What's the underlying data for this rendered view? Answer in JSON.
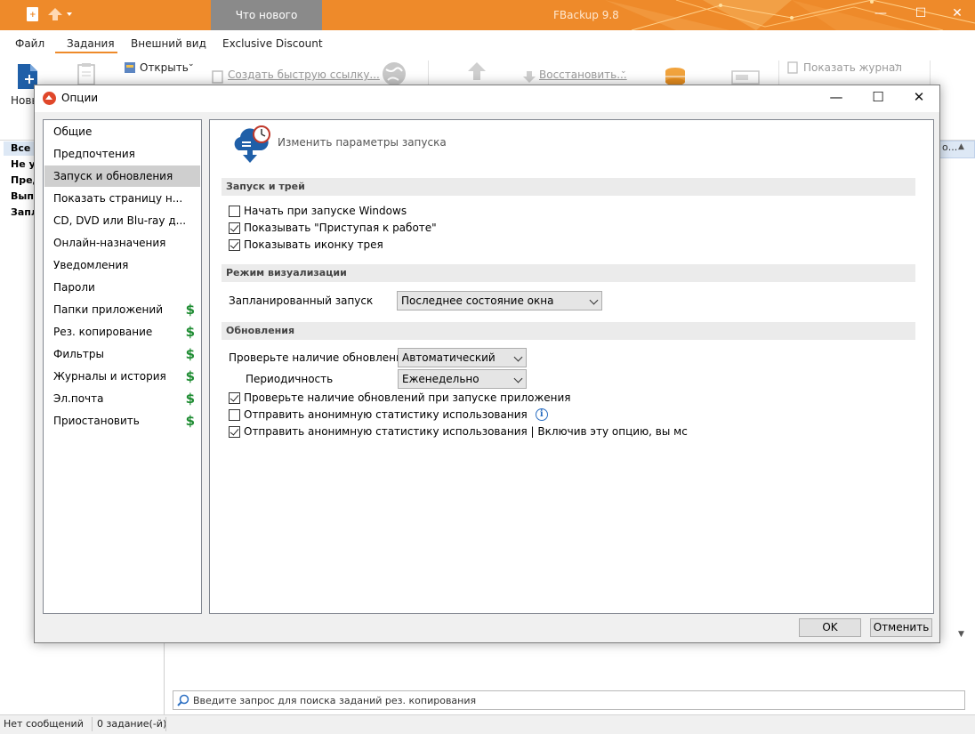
{
  "app": {
    "title": "FBackup 9.8",
    "whats_new": "Что нового",
    "window_controls": {
      "minimize": "—",
      "maximize": "☐",
      "close": "✕"
    }
  },
  "menu": [
    "Файл",
    "Задания",
    "Внешний вид",
    "Exclusive Discount"
  ],
  "ribbon": {
    "new_label": "Новы",
    "open_label": "Открыть",
    "quick_link_label": "Создать быструю ссылку...",
    "restore_label": "Восстановить...",
    "show_log_label": "Показать журнал"
  },
  "left_pane": {
    "items": [
      "Все з",
      "Не уд",
      "Пред",
      "Выпо",
      "Запл"
    ]
  },
  "right_column": {
    "header_tail": "о..."
  },
  "search": {
    "placeholder": "Введите запрос для поиска заданий рез. копирования"
  },
  "status": {
    "messages": "Нет сообщений",
    "jobs": "0 задание(-й)"
  },
  "dialog": {
    "title": "Опции",
    "nav": [
      {
        "label": "Общие",
        "paid": false,
        "selected": false
      },
      {
        "label": "Предпочтения",
        "paid": false,
        "selected": false
      },
      {
        "label": "Запуск и обновления",
        "paid": false,
        "selected": true
      },
      {
        "label": "Показать страницу н...",
        "paid": false,
        "selected": false
      },
      {
        "label": "CD, DVD или Blu-ray д...",
        "paid": false,
        "selected": false
      },
      {
        "label": "Онлайн-назначения",
        "paid": false,
        "selected": false
      },
      {
        "label": "Уведомления",
        "paid": false,
        "selected": false
      },
      {
        "label": "Пароли",
        "paid": false,
        "selected": false
      },
      {
        "label": "Папки приложений",
        "paid": true,
        "selected": false
      },
      {
        "label": "Рез. копирование",
        "paid": true,
        "selected": false
      },
      {
        "label": "Фильтры",
        "paid": true,
        "selected": false
      },
      {
        "label": "Журналы и история",
        "paid": true,
        "selected": false
      },
      {
        "label": "Эл.почта",
        "paid": true,
        "selected": false
      },
      {
        "label": "Приостановить",
        "paid": true,
        "selected": false
      }
    ],
    "paid_symbol": "$",
    "header": "Изменить параметры запуска",
    "sections": {
      "startup_tray": {
        "title": "Запуск и трей",
        "options": [
          {
            "label": "Начать при запуске Windows",
            "checked": false
          },
          {
            "label": "Показывать \"Приступая к работе\"",
            "checked": true
          },
          {
            "label": "Показывать иконку трея",
            "checked": true
          }
        ]
      },
      "view_mode": {
        "title": "Режим визуализации",
        "scheduled_label": "Запланированный запуск",
        "scheduled_value": "Последнее состояние окна"
      },
      "updates": {
        "title": "Обновления",
        "check_label": "Проверьте наличие обновлений",
        "check_value": "Автоматический",
        "period_label": "Периодичность",
        "period_value": "Еженедельно",
        "options": [
          {
            "label": "Проверьте наличие обновлений при запуске приложения",
            "checked": true
          },
          {
            "label": "Отправить анонимную статистику использования",
            "checked": false
          },
          {
            "label": "Отправить анонимную статистику использования | Включив эту опцию, вы мс",
            "checked": true
          }
        ],
        "info_symbol": "i"
      }
    },
    "buttons": {
      "ok": "OK",
      "cancel": "Отменить"
    }
  },
  "colors": {
    "accent": "#ee8a2a",
    "paid": "#1e8c32",
    "selection": "#cfcfcf"
  }
}
